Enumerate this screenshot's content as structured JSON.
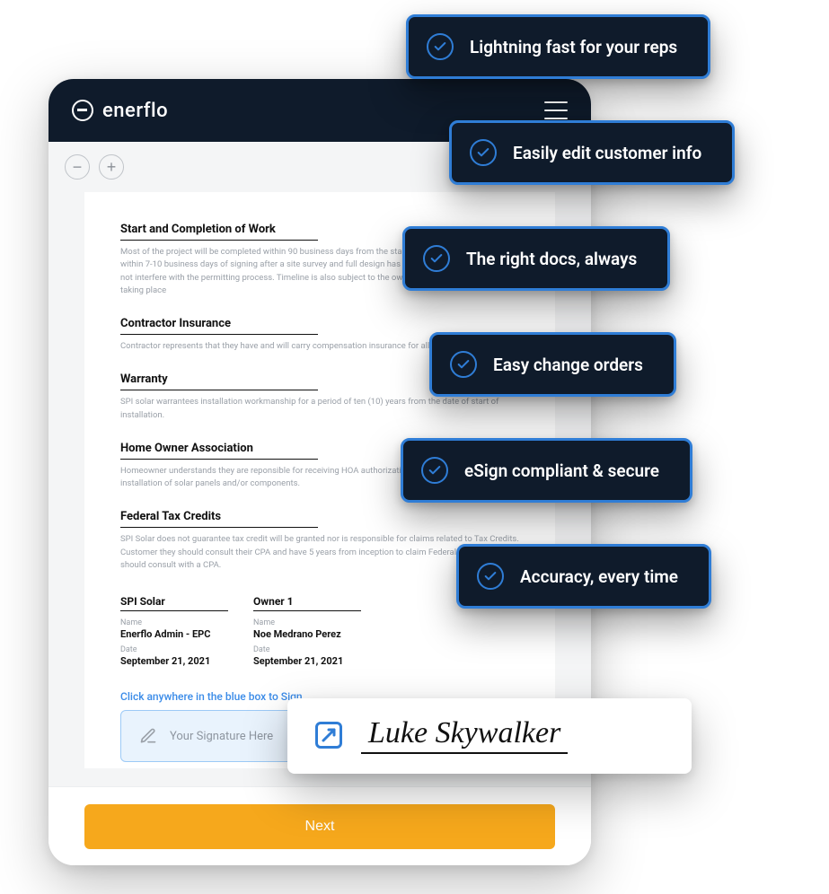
{
  "brand": {
    "name": "enerflo"
  },
  "toolbar": {
    "zoom_out": "−",
    "zoom_in": "+"
  },
  "doc": {
    "sections": [
      {
        "title": "Start and Completion of Work",
        "body": "Most of the  project will be completed within 90 business days from the start of work, and work shall start within 7-10 business days of signing after a site survey and full design has been completed. Owner shall not interfere with the permitting process. Timeline is also subject to the owner city where the work is taking place"
      },
      {
        "title": "Contractor Insurance",
        "body": "Contractor represents that they have and will carry compensation insurance for all employees."
      },
      {
        "title": "Warranty",
        "body": "SPI solar warrantees installation workmanship for a period of ten (10) years from the date of start of installation."
      },
      {
        "title": "Home Owner Association",
        "body": "Homeowner understands they are reponsible for receiving HOA authorization prior to starting the installation of solar panels and/or components."
      },
      {
        "title": "Federal Tax Credits",
        "body": "SPI Solar does not guarantee tax credit will be granted nor is responsible for claims related to Tax Credits. Customer they should consult their CPA and have 5 years from inception to claim Federal Tax Credit, and should consult with a CPA."
      }
    ],
    "signatures": {
      "left": {
        "party": "SPI Solar",
        "name_label": "Name",
        "name_value": "Enerflo Admin - EPC",
        "date_label": "Date",
        "date_value": "September 21, 2021"
      },
      "right": {
        "party": "Owner 1",
        "name_label": "Name",
        "name_value": "Noe Medrano Perez",
        "date_label": "Date",
        "date_value": "September 21, 2021"
      }
    },
    "sign_hint": "Click anywhere in the blue box to Sign",
    "sign_placeholder": "Your Signature Here"
  },
  "footer": {
    "next_label": "Next"
  },
  "badges": [
    "Lightning fast for your reps",
    "Easily edit customer info",
    "The right docs, always",
    "Easy change orders",
    "eSign compliant & secure",
    "Accuracy, every time"
  ],
  "signature_popover": {
    "name": "Luke Skywalker"
  },
  "colors": {
    "accent": "#2f7dd6",
    "dark": "#0f1b2b",
    "cta": "#f6a81c"
  }
}
